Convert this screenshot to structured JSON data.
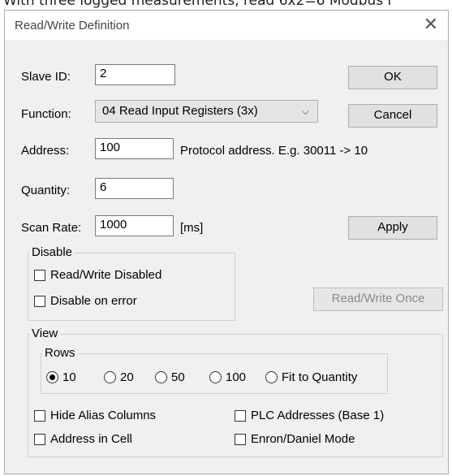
{
  "background_text": "With three logged measurements, read 6x2=6 Modbus r",
  "dialog": {
    "title": "Read/Write Definition",
    "close_icon": "close-icon"
  },
  "slave_id": {
    "label": "Slave ID:",
    "value": "2"
  },
  "function": {
    "label": "Function:",
    "selected": "04 Read Input Registers (3x)"
  },
  "address": {
    "label": "Address:",
    "value": "100",
    "hint": "Protocol address. E.g. 30011 -> 10"
  },
  "quantity": {
    "label": "Quantity:",
    "value": "6"
  },
  "scan_rate": {
    "label": "Scan Rate:",
    "value": "1000",
    "unit": "[ms]"
  },
  "buttons": {
    "ok": "OK",
    "cancel": "Cancel",
    "apply": "Apply",
    "read_write_once": "Read/Write Once"
  },
  "disable_group": {
    "title": "Disable",
    "read_write_disabled": {
      "label": "Read/Write Disabled",
      "checked": false
    },
    "disable_on_error": {
      "label": "Disable on error",
      "checked": false
    }
  },
  "view_group": {
    "title": "View",
    "rows": {
      "title": "Rows",
      "options": [
        "10",
        "20",
        "50",
        "100",
        "Fit to Quantity"
      ],
      "selected": "10"
    },
    "hide_alias_columns": {
      "label": "Hide Alias Columns",
      "checked": false
    },
    "plc_addresses": {
      "label": "PLC Addresses (Base 1)",
      "checked": false
    },
    "address_in_cell": {
      "label": "Address in Cell",
      "checked": false
    },
    "enron_daniel_mode": {
      "label": "Enron/Daniel Mode",
      "checked": false
    }
  }
}
